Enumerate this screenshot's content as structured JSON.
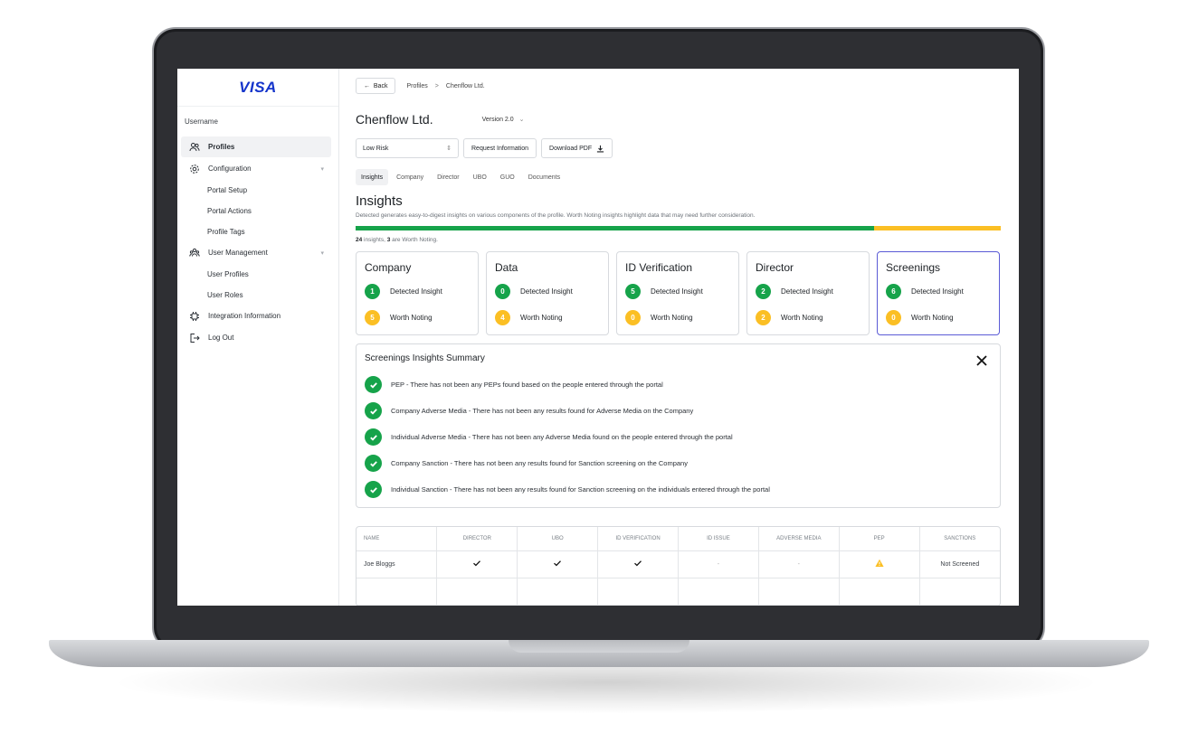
{
  "brand": {
    "logo_text": "VISA",
    "color": "#1434cb"
  },
  "sidebar": {
    "username": "Username",
    "items": [
      {
        "label": "Profiles",
        "icon": "users-icon",
        "active": true
      },
      {
        "label": "Configuration",
        "icon": "gear-icon",
        "expandable": true
      },
      {
        "label": "Portal Setup",
        "sub": true
      },
      {
        "label": "Portal Actions",
        "sub": true
      },
      {
        "label": "Profile Tags",
        "sub": true
      },
      {
        "label": "User Management",
        "icon": "user-group-icon",
        "expandable": true
      },
      {
        "label": "User Profiles",
        "sub": true
      },
      {
        "label": "User Roles",
        "sub": true
      },
      {
        "label": "Integration Information",
        "icon": "chip-icon"
      },
      {
        "label": "Log Out",
        "icon": "logout-icon"
      }
    ]
  },
  "header": {
    "back_label": "Back",
    "breadcrumb": [
      "Profiles",
      "Chenflow Ltd."
    ],
    "title": "Chenflow Ltd.",
    "version": "Version 2.0"
  },
  "actions": {
    "risk_value": "Low Risk",
    "request_label": "Request Information",
    "download_label": "Download PDF"
  },
  "tabs": [
    "Insights",
    "Company",
    "Director",
    "UBO",
    "GUO",
    "Documents"
  ],
  "insights": {
    "title": "Insights",
    "description": "Detected generates easy-to-digest insights on various components of the profile. Worth Noting insights highlight data that may need further consideration.",
    "total": "24",
    "total_suffix": " insights, ",
    "worth": "3",
    "worth_suffix": " are Worth Noting.",
    "progress": {
      "detected_fraction": 0.804
    },
    "colors": {
      "detected": "#16a34a",
      "worth": "#fbbf24",
      "selected_border": "#5b5bd6"
    }
  },
  "cards": [
    {
      "title": "Company",
      "detected": "1",
      "worth": "5"
    },
    {
      "title": "Data",
      "detected": "0",
      "worth": "4"
    },
    {
      "title": "ID Verification",
      "detected": "5",
      "worth": "0"
    },
    {
      "title": "Director",
      "detected": "2",
      "worth": "2"
    },
    {
      "title": "Screenings",
      "detected": "6",
      "worth": "0",
      "selected": true
    }
  ],
  "card_labels": {
    "detected": "Detected Insight",
    "worth": "Worth Noting"
  },
  "summary": {
    "title": "Screenings Insights Summary",
    "items": [
      "PEP - There has not been any PEPs found based on the people entered through the portal",
      "Company Adverse Media - There has not been any results found for Adverse Media on the Company",
      "Individual Adverse Media - There has not been any Adverse Media found on the people entered through the portal",
      "Company Sanction - There has not been any results found for Sanction screening on the Company",
      "Individual Sanction - There has not been any results found for Sanction screening on the individuals entered through the portal"
    ]
  },
  "table": {
    "headers": [
      "NAME",
      "DIRECTOR",
      "UBO",
      "ID VERIFICATION",
      "ID ISSUE",
      "ADVERSE MEDIA",
      "PEP",
      "SANCTIONS"
    ],
    "rows": [
      {
        "name": "Joe Bloggs",
        "director": "check",
        "ubo": "check",
        "id_verification": "check",
        "id_issue": "-",
        "adverse_media": "-",
        "pep": "warning",
        "sanctions": "Not Screened"
      }
    ]
  }
}
